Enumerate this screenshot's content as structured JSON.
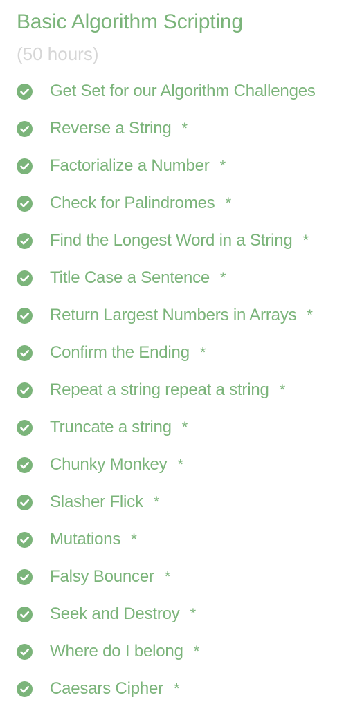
{
  "section": {
    "title": "Basic Algorithm Scripting",
    "hours": "(50 hours)"
  },
  "challenges": [
    {
      "label": "Get Set for our Algorithm Challenges",
      "star": ""
    },
    {
      "label": "Reverse a String",
      "star": "*"
    },
    {
      "label": "Factorialize a Number",
      "star": "*"
    },
    {
      "label": "Check for Palindromes",
      "star": "*"
    },
    {
      "label": "Find the Longest Word in a String",
      "star": "*"
    },
    {
      "label": "Title Case a Sentence",
      "star": "*"
    },
    {
      "label": "Return Largest Numbers in Arrays",
      "star": "*"
    },
    {
      "label": "Confirm the Ending",
      "star": "*"
    },
    {
      "label": "Repeat a string repeat a string",
      "star": "*"
    },
    {
      "label": "Truncate a string",
      "star": "*"
    },
    {
      "label": "Chunky Monkey",
      "star": "*"
    },
    {
      "label": "Slasher Flick",
      "star": "*"
    },
    {
      "label": "Mutations",
      "star": "*"
    },
    {
      "label": "Falsy Bouncer",
      "star": "*"
    },
    {
      "label": "Seek and Destroy",
      "star": "*"
    },
    {
      "label": "Where do I belong",
      "star": "*"
    },
    {
      "label": "Caesars Cipher",
      "star": "*"
    }
  ],
  "icons": {
    "completed": "check-circle-icon"
  },
  "colors": {
    "accent": "#7bb47a",
    "muted": "#d6d6d6",
    "background": "#ffffff"
  }
}
